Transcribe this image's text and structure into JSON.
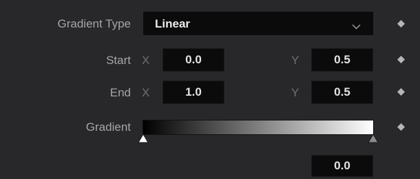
{
  "gradient_type": {
    "label": "Gradient Type",
    "value": "Linear",
    "chevron": "chevron-down-icon"
  },
  "start": {
    "label": "Start",
    "x_label": "X",
    "x_value": "0.0",
    "y_label": "Y",
    "y_value": "0.5"
  },
  "end": {
    "label": "End",
    "x_label": "X",
    "x_value": "1.0",
    "y_label": "Y",
    "y_value": "0.5"
  },
  "gradient": {
    "label": "Gradient",
    "color_start": "#000000",
    "color_end": "#ffffff",
    "stops": [
      {
        "position": 0.0,
        "color": "#ffffff",
        "selected": true
      },
      {
        "position": 1.0,
        "color": "#8c8c8c",
        "selected": false
      }
    ],
    "selected_stop_position": "0.0"
  },
  "keyframe_icon": "diamond-keyframe-icon",
  "colors": {
    "background": "#28282b",
    "field": "#0b0b0c",
    "label": "#a6a6aa",
    "axis": "#6f6f74"
  }
}
